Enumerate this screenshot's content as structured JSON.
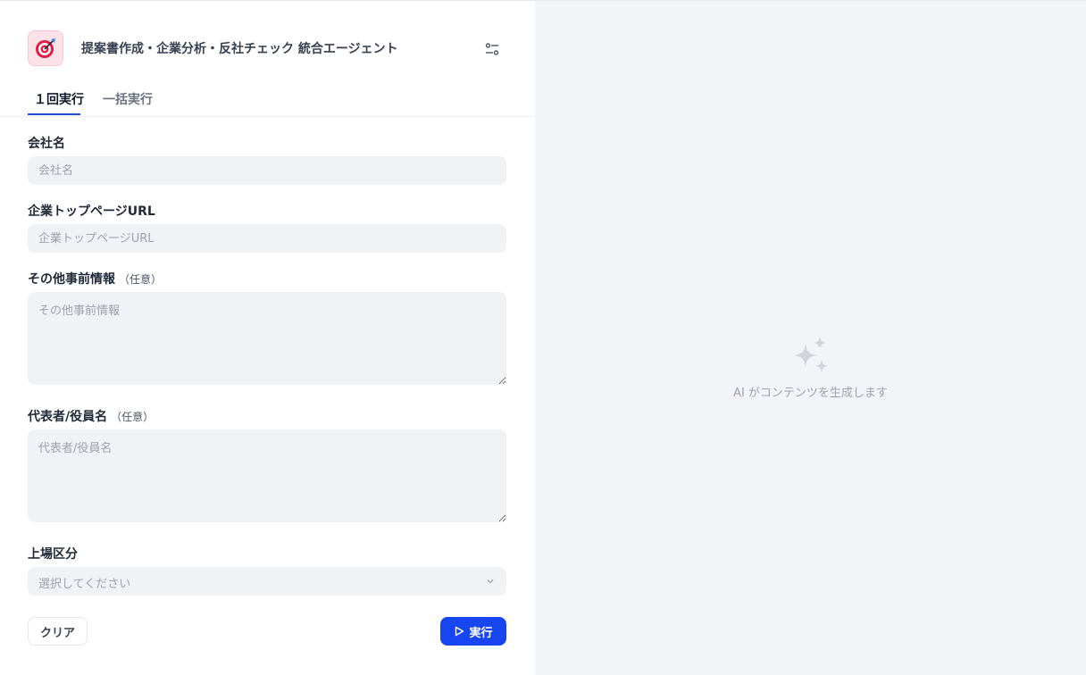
{
  "app": {
    "title": "提案書作成・企業分析・反社チェック 統合エージェント",
    "icon": "target-icon",
    "accent_color": "#1746f0",
    "icon_bg_color": "#fde2e8"
  },
  "tabs": [
    {
      "label": "１回実行",
      "active": true
    },
    {
      "label": "一括実行",
      "active": false
    }
  ],
  "form": {
    "company_name": {
      "label": "会社名",
      "placeholder": "会社名",
      "value": ""
    },
    "company_url": {
      "label": "企業トップページURL",
      "placeholder": "企業トップページURL",
      "value": ""
    },
    "other_info": {
      "label": "その他事前情報",
      "optional": "（任意）",
      "placeholder": "その他事前情報",
      "value": ""
    },
    "representative": {
      "label": "代表者/役員名",
      "optional": "（任意）",
      "placeholder": "代表者/役員名",
      "value": ""
    },
    "listing": {
      "label": "上場区分",
      "placeholder": "選択してください",
      "value": ""
    }
  },
  "actions": {
    "clear_label": "クリア",
    "run_label": "実行"
  },
  "output": {
    "empty_text": "AI がコンテンツを生成します",
    "empty_icon": "sparkles-icon"
  }
}
